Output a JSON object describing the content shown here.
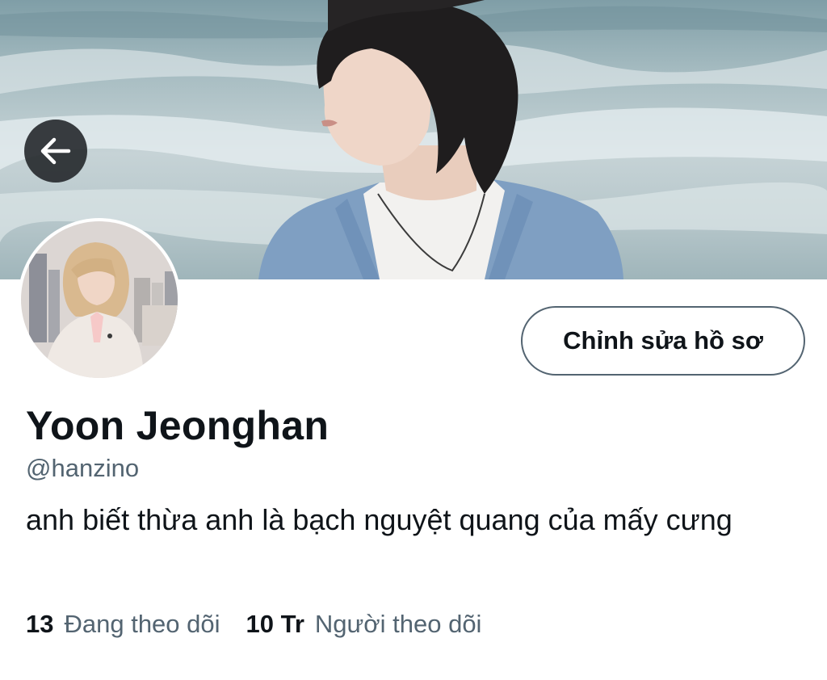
{
  "profile": {
    "display_name": "Yoon Jeonghan",
    "handle": "@hanzino",
    "bio": "anh biết thừa anh là bạch nguyệt quang của mấy cưng",
    "edit_button_label": "Chỉnh sửa hồ sơ"
  },
  "stats": {
    "following_count": "13",
    "following_label": "Đang theo dõi",
    "followers_count": "10 Tr",
    "followers_label": "Người theo dõi"
  },
  "icons": {
    "back": "arrow-left-icon"
  },
  "colors": {
    "primary_text": "#0f1419",
    "secondary_text": "#536471",
    "back_button_bg": "#202327"
  }
}
